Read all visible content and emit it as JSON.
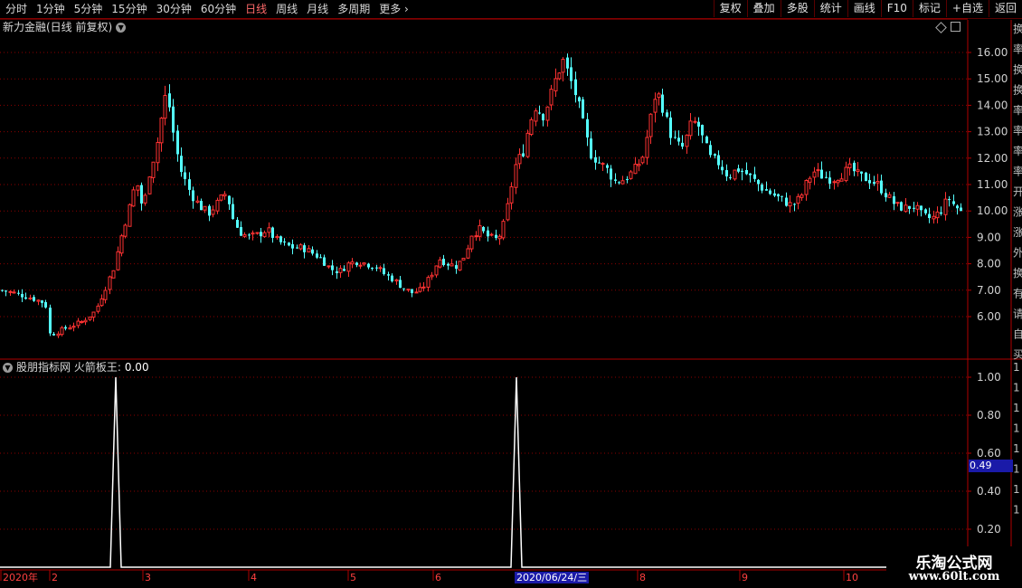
{
  "toolbar": {
    "periods": [
      "分时",
      "1分钟",
      "5分钟",
      "15分钟",
      "30分钟",
      "60分钟",
      "日线",
      "周线",
      "月线",
      "多周期",
      "更多"
    ],
    "active_period": "日线",
    "buttons": [
      "复权",
      "叠加",
      "多股",
      "统计",
      "画线",
      "F10",
      "标记",
      "+自选",
      "返回"
    ]
  },
  "main_chart": {
    "title": "新力金融(日线 前复权)",
    "y_ticks": [
      "16.00",
      "15.00",
      "14.00",
      "13.00",
      "12.00",
      "11.00",
      "10.00",
      "9.00",
      "8.00",
      "7.00",
      "6.00"
    ]
  },
  "indicator": {
    "title": "股朋指标网 火箭板王:",
    "value": "0.00",
    "y_ticks": [
      "1.00",
      "0.80",
      "0.60",
      "0.40",
      "0.20"
    ],
    "cursor_value": "0.49"
  },
  "x_axis": {
    "labels": [
      "2020年",
      "2",
      "3",
      "4",
      "5",
      "6",
      "2020/06/24/三",
      "8",
      "9",
      "10"
    ],
    "selected_date": "2020/06/24/三"
  },
  "right_panel": {
    "glyphs": [
      "换",
      "率",
      "换",
      "换",
      "率",
      "率",
      "率",
      "率",
      "开",
      "涨",
      "涨",
      "外",
      "换",
      "有",
      "请",
      "自",
      "买",
      "1",
      "1",
      "1",
      "1",
      "1",
      "1",
      "1",
      "1"
    ]
  },
  "watermark": {
    "title": "乐淘公式网",
    "url": "www.60lt.com"
  },
  "colors": {
    "up": "#ff3232",
    "down": "#54ffff",
    "grid": "#8b0000",
    "axis": "#b00000",
    "signal": "#ffffff"
  },
  "chart_data": {
    "type": "candlestick",
    "title": "新力金融(日线 前复权)",
    "x_range": [
      "2020-01",
      "2020-10"
    ],
    "ylim": [
      5.0,
      16.7
    ],
    "price_path": [
      [
        0,
        7.0
      ],
      [
        8,
        6.95
      ],
      [
        20,
        6.85
      ],
      [
        35,
        6.7
      ],
      [
        50,
        6.5
      ],
      [
        55,
        5.3
      ],
      [
        62,
        5.4
      ],
      [
        75,
        5.6
      ],
      [
        90,
        5.8
      ],
      [
        105,
        6.2
      ],
      [
        115,
        7.0
      ],
      [
        125,
        7.8
      ],
      [
        135,
        9.2
      ],
      [
        145,
        10.4
      ],
      [
        150,
        11.2
      ],
      [
        158,
        10.0
      ],
      [
        165,
        11.5
      ],
      [
        172,
        12.3
      ],
      [
        178,
        13.5
      ],
      [
        183,
        14.4
      ],
      [
        188,
        13.8
      ],
      [
        193,
        12.5
      ],
      [
        200,
        11.5
      ],
      [
        210,
        10.7
      ],
      [
        220,
        10.2
      ],
      [
        230,
        9.9
      ],
      [
        240,
        10.3
      ],
      [
        250,
        10.7
      ],
      [
        258,
        9.6
      ],
      [
        265,
        9.2
      ],
      [
        275,
        9.0
      ],
      [
        285,
        9.1
      ],
      [
        295,
        9.3
      ],
      [
        305,
        8.9
      ],
      [
        315,
        8.7
      ],
      [
        325,
        8.6
      ],
      [
        335,
        8.6
      ],
      [
        345,
        8.4
      ],
      [
        355,
        8.2
      ],
      [
        365,
        7.8
      ],
      [
        375,
        7.7
      ],
      [
        385,
        8.0
      ],
      [
        395,
        8.1
      ],
      [
        405,
        8.0
      ],
      [
        415,
        7.9
      ],
      [
        425,
        7.6
      ],
      [
        435,
        7.4
      ],
      [
        445,
        7.1
      ],
      [
        455,
        6.9
      ],
      [
        465,
        7.0
      ],
      [
        475,
        7.5
      ],
      [
        485,
        8.2
      ],
      [
        495,
        8.0
      ],
      [
        505,
        7.9
      ],
      [
        515,
        8.4
      ],
      [
        520,
        9.1
      ],
      [
        530,
        9.3
      ],
      [
        540,
        9.0
      ],
      [
        550,
        8.9
      ],
      [
        558,
        9.6
      ],
      [
        563,
        10.6
      ],
      [
        570,
        11.8
      ],
      [
        578,
        12.2
      ],
      [
        585,
        13.3
      ],
      [
        592,
        14.0
      ],
      [
        600,
        13.6
      ],
      [
        608,
        14.3
      ],
      [
        615,
        15.1
      ],
      [
        622,
        15.7
      ],
      [
        630,
        15.0
      ],
      [
        638,
        14.2
      ],
      [
        645,
        13.2
      ],
      [
        652,
        12.2
      ],
      [
        660,
        11.9
      ],
      [
        670,
        11.6
      ],
      [
        680,
        11.1
      ],
      [
        690,
        11.2
      ],
      [
        700,
        11.5
      ],
      [
        710,
        12.0
      ],
      [
        718,
        13.3
      ],
      [
        725,
        14.6
      ],
      [
        732,
        14.0
      ],
      [
        740,
        13.0
      ],
      [
        748,
        12.5
      ],
      [
        755,
        12.4
      ],
      [
        763,
        13.2
      ],
      [
        770,
        13.4
      ],
      [
        778,
        12.6
      ],
      [
        785,
        12.0
      ],
      [
        795,
        11.8
      ],
      [
        805,
        11.3
      ],
      [
        815,
        11.6
      ],
      [
        825,
        11.4
      ],
      [
        835,
        11.1
      ],
      [
        845,
        10.8
      ],
      [
        855,
        10.6
      ],
      [
        865,
        10.4
      ],
      [
        875,
        10.2
      ],
      [
        885,
        10.5
      ],
      [
        893,
        11.2
      ],
      [
        900,
        11.5
      ],
      [
        910,
        11.3
      ],
      [
        920,
        11.2
      ],
      [
        930,
        11.4
      ],
      [
        940,
        11.6
      ],
      [
        950,
        11.3
      ],
      [
        960,
        11.2
      ],
      [
        970,
        11.0
      ],
      [
        980,
        10.6
      ],
      [
        990,
        10.2
      ],
      [
        1000,
        10.1
      ],
      [
        1010,
        10.2
      ],
      [
        1020,
        9.8
      ],
      [
        1030,
        9.7
      ],
      [
        1040,
        10.0
      ],
      [
        1048,
        10.5
      ],
      [
        1055,
        10.2
      ],
      [
        1068,
        9.8
      ]
    ],
    "indicator_series": {
      "name": "火箭板王",
      "spikes": [
        {
          "date": "2020-02",
          "value": 1.0
        },
        {
          "date": "2020-06",
          "value": 1.0
        }
      ],
      "baseline": 0.0,
      "ylim": [
        0,
        1.05
      ]
    }
  }
}
